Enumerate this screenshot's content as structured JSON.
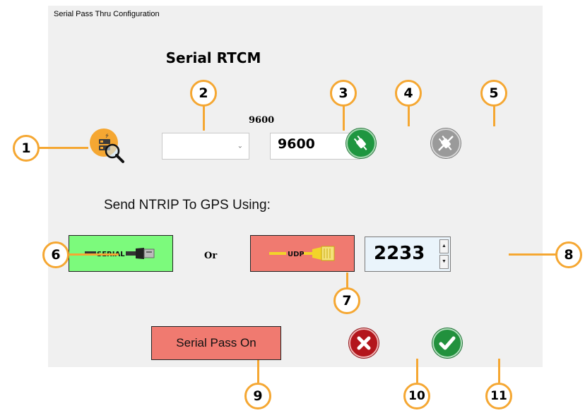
{
  "window": {
    "title": "Serial Pass Thru Configuration"
  },
  "heading": "Serial RTCM",
  "port_combo": {
    "value": ""
  },
  "baud": {
    "caption": "9600",
    "value": "9600"
  },
  "send_label": "Send NTRIP To GPS Using:",
  "serial_button": {
    "label": "SERIAL"
  },
  "or_label": "Or",
  "udp_button": {
    "label": "UDP"
  },
  "udp_port": {
    "value": "2233"
  },
  "serial_pass_button": {
    "label": "Serial Pass On"
  },
  "callouts": [
    "1",
    "2",
    "3",
    "4",
    "5",
    "6",
    "7",
    "8",
    "9",
    "10",
    "11"
  ],
  "colors": {
    "callout_ring": "#f5a732",
    "serial_green": "#7cfa7c",
    "udp_red": "#f07a70",
    "connect_green": "#1f9640",
    "cancel_red": "#b3161c"
  },
  "icons": {
    "usb_search": "usb-search-icon",
    "connect": "plug-connect-icon",
    "disconnect": "plug-disconnect-icon",
    "usb_cable": "usb-cable-icon",
    "ethernet_cable": "ethernet-cable-icon",
    "cancel": "x-cancel-icon",
    "ok": "checkmark-icon"
  }
}
